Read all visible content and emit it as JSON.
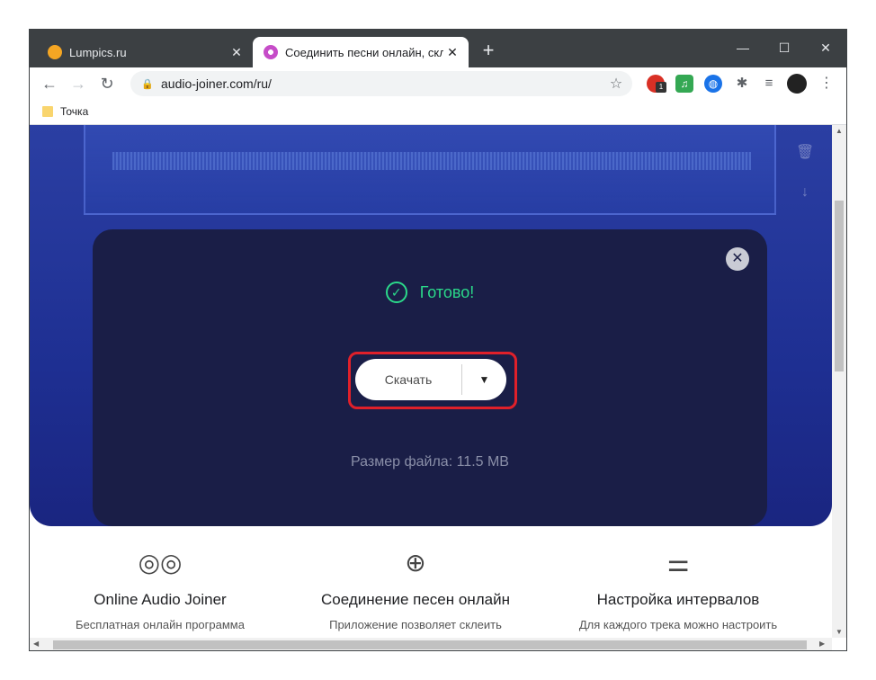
{
  "browser": {
    "tabs": [
      {
        "title": "Lumpics.ru",
        "close": "✕"
      },
      {
        "title": "Соединить песни онлайн, скле",
        "close": "✕"
      }
    ],
    "new_tab": "+",
    "controls": {
      "minimize": "—",
      "maximize": "☐",
      "close": "✕"
    },
    "nav": {
      "back": "←",
      "forward": "→",
      "reload": "↻"
    },
    "url": "audio-joiner.com/ru/",
    "bookmarks": [
      {
        "label": "Точка"
      }
    ],
    "extension_badge": "1"
  },
  "page": {
    "modal": {
      "close": "✕",
      "status": "Готово!",
      "download_label": "Скачать",
      "dropdown": "▼",
      "file_size": "Размер файла: 11.5 MB"
    },
    "features": [
      {
        "title": "Online Audio Joiner",
        "desc": "Бесплатная онлайн программа"
      },
      {
        "title": "Соединение песен онлайн",
        "desc": "Приложение позволяет склеить"
      },
      {
        "title": "Настройка интервалов",
        "desc": "Для каждого трека можно настроить"
      }
    ]
  },
  "colors": {
    "accent_green": "#2bd98a",
    "highlight_red": "#e0202a",
    "modal_bg": "#1a1e47"
  }
}
